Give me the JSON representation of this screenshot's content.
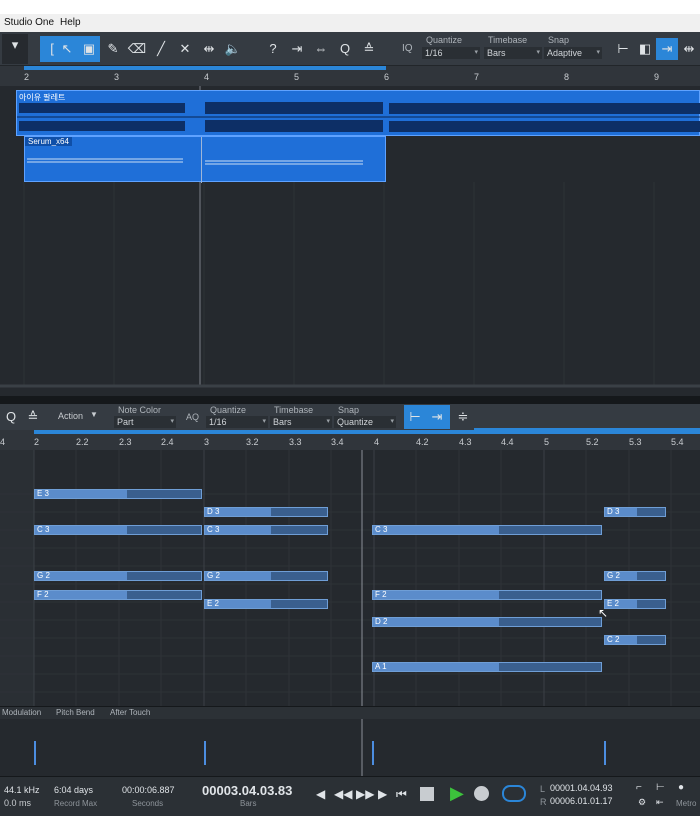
{
  "menu": {
    "app": "Studio One",
    "help": "Help"
  },
  "toolbar": {
    "quantize_label": "Quantize",
    "quantize_value": "1/16",
    "timebase_label": "Timebase",
    "timebase_value": "Bars",
    "snap_label": "Snap",
    "snap_value": "Adaptive",
    "iq": "IQ"
  },
  "arrange": {
    "ruler": [
      "2",
      "3",
      "4",
      "5",
      "6",
      "7",
      "8",
      "9"
    ],
    "audio_clip_name": "아이유 팔레트",
    "instrument_clip_name": "Serum_x64"
  },
  "piano_toolbar": {
    "action": "Action",
    "note_color_label": "Note Color",
    "note_color_value": "Part",
    "aq": "AQ",
    "quantize_label": "Quantize",
    "quantize_value": "1/16",
    "timebase_label": "Timebase",
    "timebase_value": "Bars",
    "snap_label": "Snap",
    "snap_value": "Quantize"
  },
  "piano_ruler": [
    "4",
    "2",
    "2.2",
    "2.3",
    "2.4",
    "3",
    "3.2",
    "3.3",
    "3.4",
    "4",
    "4.2",
    "4.3",
    "4.4",
    "5",
    "5.2",
    "5.3",
    "5.4"
  ],
  "notes": [
    "E 3",
    "D 3",
    "C 3",
    "C 3",
    "C 3",
    "D 3",
    "G 2",
    "G 2",
    "G 2",
    "F 2",
    "E 2",
    "F 2",
    "E 2",
    "D 2",
    "C 2",
    "A 1"
  ],
  "automation_tabs": [
    "Modulation",
    "Pitch Bend",
    "After Touch"
  ],
  "transport": {
    "sample_rate": "44.1 kHz",
    "latency": "0.0 ms",
    "record_max_value": "6:04 days",
    "record_max_label": "Record Max",
    "seconds_value": "00:00:06.887",
    "seconds_label": "Seconds",
    "bars_value": "00003.04.03.83",
    "bars_label": "Bars",
    "loop_l_label": "L",
    "loop_l": "00001.04.04.93",
    "loop_r_label": "R",
    "loop_r": "00006.01.01.17",
    "metronome": "Metro"
  },
  "colors": {
    "accent": "#2b86d8",
    "clip": "#1f6fd8",
    "note": "#5b8ccb",
    "play": "#3cc23c"
  }
}
